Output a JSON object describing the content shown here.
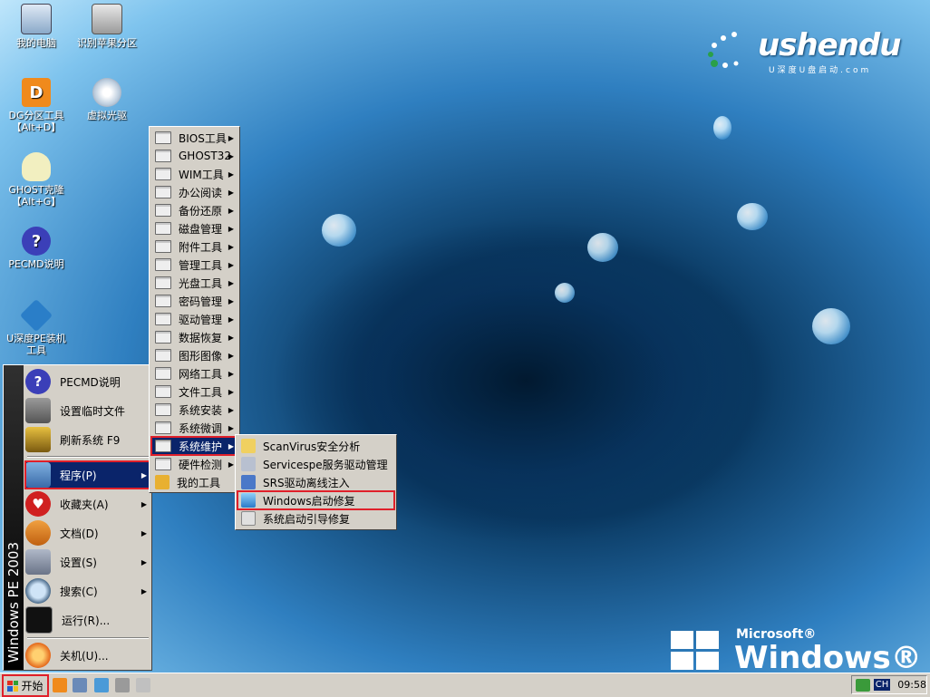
{
  "desktop": {
    "icons": [
      {
        "label": "我的电脑"
      },
      {
        "label": "识别苹果分区"
      },
      {
        "label": "DG分区工具",
        "label2": "【Alt+D】"
      },
      {
        "label": "虚拟光驱"
      },
      {
        "label": "GHOST克隆",
        "label2": "【Alt+G】"
      },
      {
        "label": "PECMD说明"
      },
      {
        "label": "U深度PE装机",
        "label2": "工具"
      }
    ]
  },
  "branding": {
    "logo_text": "ushendu",
    "logo_sub": "U深度U盘启动.com",
    "watermark_top": "Microsoft®",
    "watermark_main": "Windows® PE"
  },
  "start_menu": {
    "band_text": "Windows PE 2003",
    "items": [
      {
        "label": "PECMD说明"
      },
      {
        "label": "设置临时文件"
      },
      {
        "label": "刷新系统 F9"
      },
      {
        "label": "程序(P)"
      },
      {
        "label": "收藏夹(A)"
      },
      {
        "label": "文档(D)"
      },
      {
        "label": "设置(S)"
      },
      {
        "label": "搜索(C)"
      },
      {
        "label": "运行(R)..."
      },
      {
        "label": "关机(U)..."
      }
    ]
  },
  "programs_menu": {
    "items": [
      {
        "label": "BIOS工具"
      },
      {
        "label": "GHOST32"
      },
      {
        "label": "WIM工具"
      },
      {
        "label": "办公阅读"
      },
      {
        "label": "备份还原"
      },
      {
        "label": "磁盘管理"
      },
      {
        "label": "附件工具"
      },
      {
        "label": "管理工具"
      },
      {
        "label": "光盘工具"
      },
      {
        "label": "密码管理"
      },
      {
        "label": "驱动管理"
      },
      {
        "label": "数据恢复"
      },
      {
        "label": "图形图像"
      },
      {
        "label": "网络工具"
      },
      {
        "label": "文件工具"
      },
      {
        "label": "系统安装"
      },
      {
        "label": "系统微调"
      },
      {
        "label": "系统维护"
      },
      {
        "label": "硬件检测"
      },
      {
        "label": "我的工具"
      }
    ]
  },
  "maintenance_menu": {
    "items": [
      {
        "label": "ScanVirus安全分析"
      },
      {
        "label": "Servicespe服务驱动管理"
      },
      {
        "label": "SRS驱动离线注入"
      },
      {
        "label": "Windows启动修复"
      },
      {
        "label": "系统启动引导修复"
      }
    ]
  },
  "taskbar": {
    "start_label": "开始",
    "lang": "CH",
    "clock": "09:58"
  },
  "colors": {
    "highlight": "#0a246a",
    "annotation_red": "#e0202a",
    "menu_bg": "#d4d0c8"
  }
}
